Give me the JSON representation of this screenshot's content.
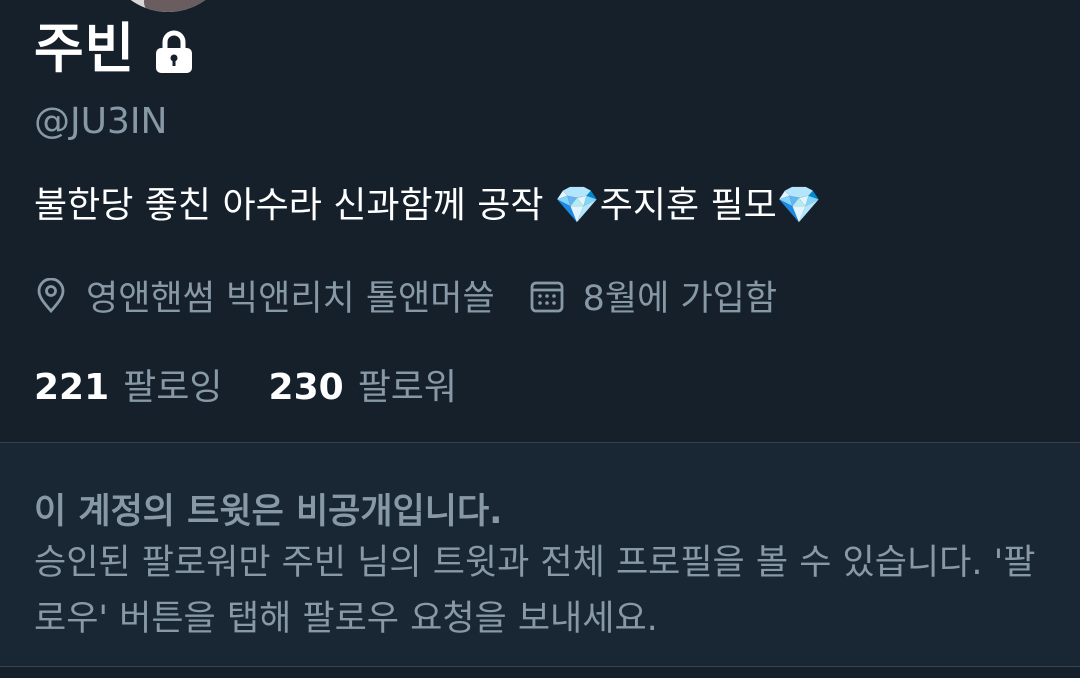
{
  "profile": {
    "display_name": "주빈",
    "handle": "@JU3IN",
    "bio": "불한당 좋친 아수라 신과함께 공작 💎주지훈 필모💎",
    "location": "영앤핸썸 빅앤리치 톨앤머쓸",
    "joined": "8월에 가입함",
    "following_count": "221",
    "following_label": "팔로잉",
    "followers_count": "230",
    "followers_label": "팔로워",
    "icons": {
      "lock": "lock-icon",
      "location": "location-pin-icon",
      "calendar": "calendar-icon"
    }
  },
  "protected_notice": {
    "title": "이 계정의 트윗은 비공개입니다.",
    "body": "승인된 팔로워만 주빈 님의 트윗과 전체 프로필을 볼 수 있습니다. '팔로우' 버튼을 탭해 팔로우 요청을 보내세요."
  },
  "colors": {
    "background": "#15202b",
    "notice_background": "#192734",
    "primary_text": "#ffffff",
    "secondary_text": "#8899a6",
    "divider": "#38444d"
  }
}
